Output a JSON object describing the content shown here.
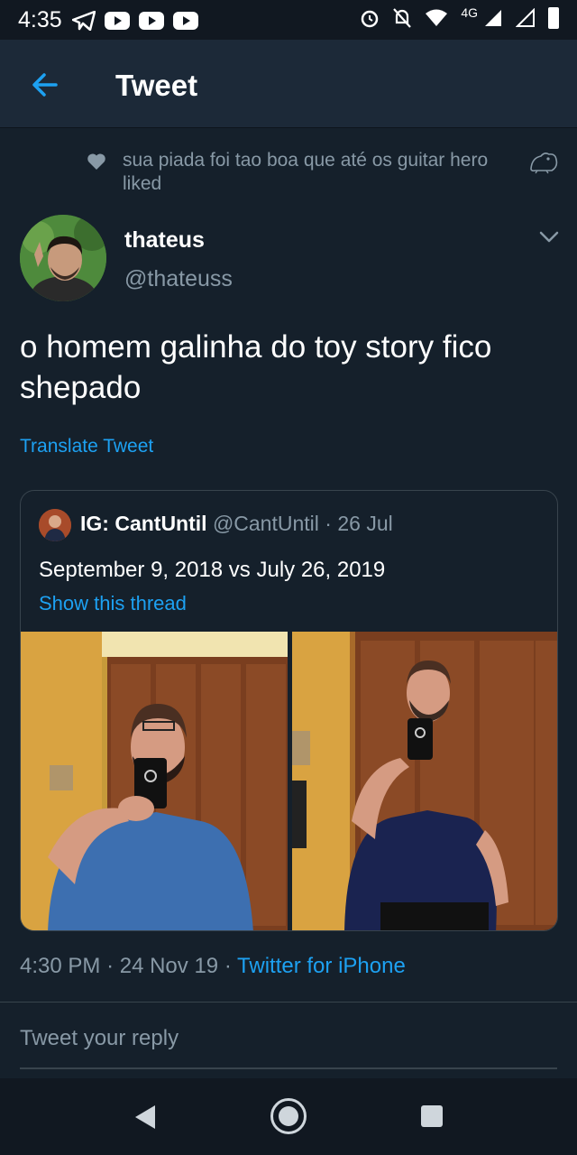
{
  "status_bar": {
    "time": "4:35",
    "network": "4G"
  },
  "header": {
    "title": "Tweet"
  },
  "liked_banner": {
    "text": "sua piada foi tao boa que até os guitar hero liked"
  },
  "tweet": {
    "display_name": "thateus",
    "handle": "@thateuss",
    "text": "o homem galinha do toy story fico shepado",
    "translate_label": "Translate Tweet",
    "time": "4:30 PM",
    "date": "24 Nov 19",
    "source": "Twitter for iPhone"
  },
  "quoted_tweet": {
    "display_name": "IG: CantUntil",
    "handle": "@CantUntil",
    "date": "26 Jul",
    "text": "September 9, 2018 vs July 26, 2019",
    "thread_link": "Show this thread"
  },
  "reply": {
    "placeholder": "Tweet your reply"
  },
  "colors": {
    "background": "#15202b",
    "header": "#1c2938",
    "accent": "#1da1f2",
    "muted": "#8899a6",
    "border": "#38444d"
  },
  "icons": [
    "telegram-icon",
    "youtube-icon",
    "alarm-icon",
    "bell-off-icon",
    "wifi-icon",
    "signal-icon",
    "battery-icon",
    "back-arrow-icon",
    "heart-icon",
    "frog-icon",
    "chevron-down-icon",
    "nav-back-icon",
    "nav-home-icon",
    "nav-recents-icon"
  ]
}
